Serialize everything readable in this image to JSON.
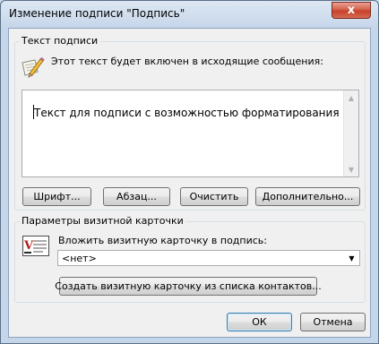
{
  "window": {
    "title": "Изменение подписи \"Подпись\"",
    "close_glyph": "x"
  },
  "signature_text_group": {
    "title": "Текст подписи",
    "description": "Этот текст будет включен в исходящие сообщения:",
    "icon": "pencil-paper-icon",
    "content": "Текст для подписи с возможностью форматирования",
    "buttons": {
      "font": "Шрифт...",
      "paragraph": "Абзац...",
      "clear": "Очистить",
      "advanced": "Дополнительно..."
    }
  },
  "business_card_group": {
    "title": "Параметры визитной карточки",
    "icon": "business-card-icon",
    "insert_label": "Вложить визитную карточку в подпись:",
    "selected_card": "<нет>",
    "create_button": "Создать визитную карточку из списка контактов..."
  },
  "footer": {
    "ok": "ОК",
    "cancel": "Отмена"
  },
  "colors": {
    "frame": "#c6d6ea",
    "close_button": "#c7422c",
    "dialog_body": "#f0f0f0"
  }
}
